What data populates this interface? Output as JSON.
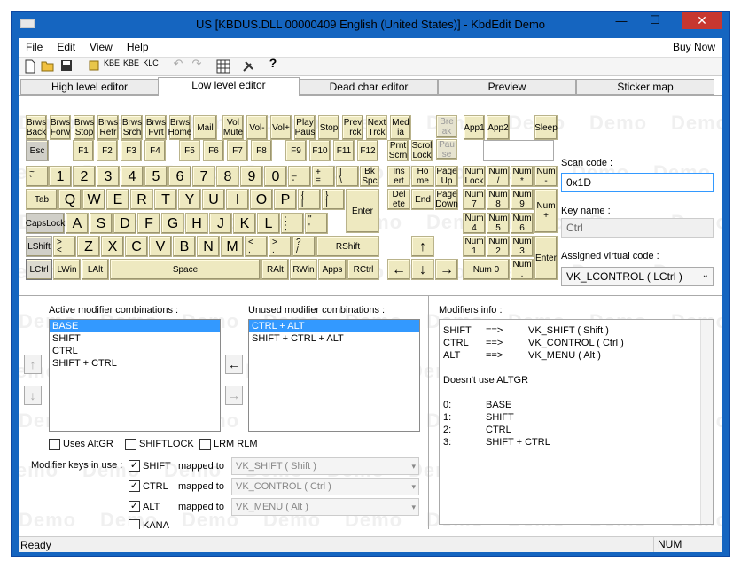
{
  "window": {
    "title": "US [KBDUS.DLL 00000409 English (United States)] - KbdEdit Demo",
    "minimize": "—",
    "maximize": "☐",
    "close": "✕"
  },
  "menu": {
    "file": "File",
    "edit": "Edit",
    "view": "View",
    "help": "Help",
    "buy_now": "Buy Now"
  },
  "toolbar": {
    "kbe1": "KBE",
    "kbe2": "KBE",
    "klc": "KLC",
    "help": "?"
  },
  "tabs": [
    "High level editor",
    "Low level editor",
    "Dead char editor",
    "Preview",
    "Sticker map"
  ],
  "watermark": "Demo",
  "keys": {
    "brws_back": "Brws\nBack",
    "brws_forw": "Brws\nForw",
    "brws_stop": "Brws\nStop",
    "brws_refr": "Brws\nRefr",
    "brws_srch": "Brws\nSrch",
    "brws_fvrt": "Brws\nFvrt",
    "brws_home": "Brws\nHome",
    "mail": "Mail",
    "vol_mute": "Vol\nMute",
    "vol_down": "Vol-",
    "vol_up": "Vol+",
    "play_paus": "Play\nPaus",
    "stop": "Stop",
    "prev_trck": "Prev\nTrck",
    "next_trck": "Next\nTrck",
    "med_ia": "Med\nia",
    "break": "Bre\nak",
    "pause": "Pau\nse",
    "app1": "App1",
    "app2": "App2",
    "sleep": "Sleep",
    "esc": "Esc",
    "f1": "F1",
    "f2": "F2",
    "f3": "F3",
    "f4": "F4",
    "f5": "F5",
    "f6": "F6",
    "f7": "F7",
    "f8": "F8",
    "f9": "F9",
    "f10": "F10",
    "f11": "F11",
    "f12": "F12",
    "prnt_scrn": "Prnt\nScrn",
    "scrol_lock": "Scrol\nLock",
    "grave_up": "~",
    "grave_dn": "`",
    "n1": "1",
    "n2": "2",
    "n3": "3",
    "n4": "4",
    "n5": "5",
    "n6": "6",
    "n7": "7",
    "n8": "8",
    "n9": "9",
    "n0": "0",
    "minus_up": "_",
    "minus_dn": "-",
    "equal_up": "+",
    "equal_dn": "=",
    "bslash_up": "|",
    "bslash_dn": "\\",
    "bkspc": "Bk\nSpc",
    "insert": "Ins\nert",
    "home": "Ho\nme",
    "page_up": "Page\nUp",
    "num_lock": "Num\nLock",
    "num_div": "Num\n/",
    "num_mul": "Num\n*",
    "num_sub": "Num\n-",
    "tab": "Tab",
    "q": "Q",
    "w": "W",
    "e": "E",
    "r": "R",
    "t": "T",
    "y": "Y",
    "u": "U",
    "i": "I",
    "o": "O",
    "p": "P",
    "lbr_up": "{",
    "lbr_dn": "[",
    "rbr_up": "}",
    "rbr_dn": "]",
    "delete": "Del\nete",
    "end": "End",
    "page_down": "Page\nDown",
    "num7": "Num\n7",
    "num8": "Num\n8",
    "num9": "Num\n9",
    "num_add": "Num\n+",
    "caps": "CapsLock",
    "a": "A",
    "s": "S",
    "d": "D",
    "f": "F",
    "g": "G",
    "h": "H",
    "j": "J",
    "k": "K",
    "l": "L",
    "semi_up": ":",
    "semi_dn": ";",
    "quote_up": "\"",
    "quote_dn": "'",
    "enter": "Enter",
    "num4": "Num\n4",
    "num5": "Num\n5",
    "num6": "Num\n6",
    "lshift": "LShift",
    "oem102_up": ">",
    "oem102_dn": "<",
    "z": "Z",
    "x": "X",
    "c": "C",
    "v": "V",
    "b": "B",
    "n": "N",
    "m": "M",
    "comma_up": "<",
    "comma_dn": ",",
    "period_up": ">",
    "period_dn": ".",
    "slash_up": "?",
    "slash_dn": "/",
    "rshift": "RShift",
    "arrow_up": "↑",
    "num1": "Num\n1",
    "num2": "Num\n2",
    "num3": "Num\n3",
    "num_enter": "Enter",
    "lctrl": "LCtrl",
    "lwin": "LWin",
    "lalt": "LAlt",
    "space": "Space",
    "ralt": "RAlt",
    "rwin": "RWin",
    "apps": "Apps",
    "rctrl": "RCtrl",
    "arrow_left": "←",
    "arrow_down": "↓",
    "arrow_right": "→",
    "num0": "Num 0",
    "num_dec": "Num\n."
  },
  "scan": {
    "label": "Scan code :",
    "value": "0x1D",
    "keyname_label": "Key name :",
    "keyname": "Ctrl",
    "vk_label": "Assigned virtual code :",
    "vk": "VK_LCONTROL ( LCtrl )"
  },
  "lower": {
    "active_label": "Active modifier combinations :",
    "active": [
      "BASE",
      "SHIFT",
      "CTRL",
      "SHIFT + CTRL"
    ],
    "unused_label": "Unused modifier combinations :",
    "unused": [
      "CTRL + ALT",
      "SHIFT + CTRL + ALT"
    ],
    "arrow_up": "↑",
    "arrow_down": "↓",
    "arrow_left": "←",
    "arrow_right": "→",
    "uses_altgr": "Uses AltGR",
    "shiftlock": "SHIFTLOCK",
    "lrm_rlm": "LRM RLM",
    "modkeys_label": "Modifier keys in use :",
    "shift": "SHIFT",
    "ctrl": "CTRL",
    "alt": "ALT",
    "kana": "KANA",
    "mapped_to": "mapped to",
    "vk_shift": "VK_SHIFT ( Shift )",
    "vk_control": "VK_CONTROL ( Ctrl )",
    "vk_menu": "VK_MENU ( Alt )"
  },
  "info": {
    "label": "Modifiers info :",
    "rows": [
      [
        "SHIFT",
        "==>",
        "VK_SHIFT ( Shift )"
      ],
      [
        "CTRL",
        "==>",
        "VK_CONTROL ( Ctrl )"
      ],
      [
        "ALT",
        "==>",
        "VK_MENU ( Alt )"
      ]
    ],
    "altgr": "Doesn't use ALTGR",
    "levels": [
      [
        "0:",
        "BASE"
      ],
      [
        "1:",
        "SHIFT"
      ],
      [
        "2:",
        "CTRL"
      ],
      [
        "3:",
        "SHIFT + CTRL"
      ]
    ]
  },
  "status": {
    "left": "Ready",
    "num": "NUM"
  }
}
